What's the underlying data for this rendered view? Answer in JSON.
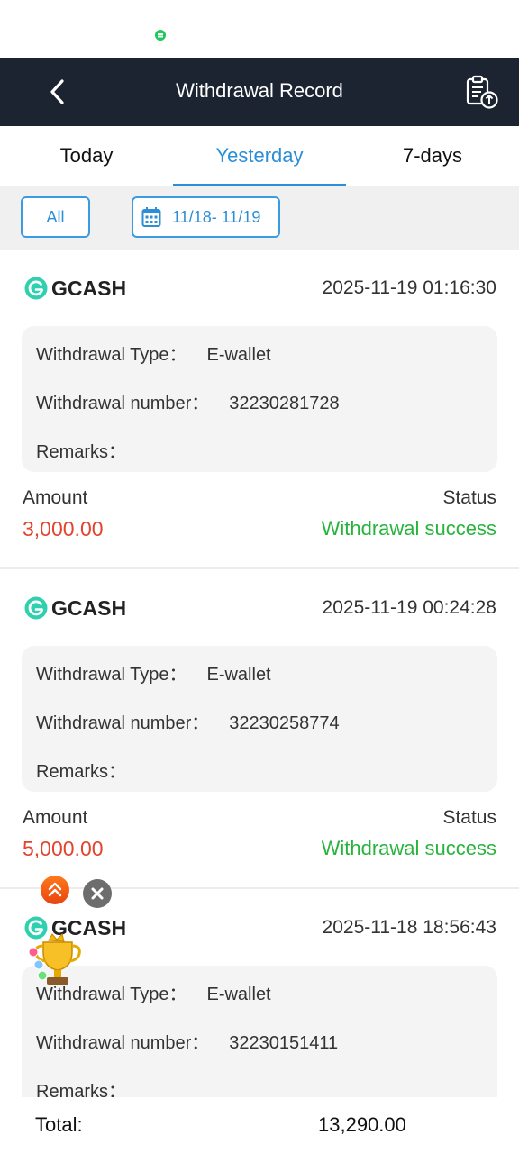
{
  "header": {
    "title": "Withdrawal Record",
    "back_icon": "chevron-left-icon",
    "export_icon": "clipboard-upload-icon"
  },
  "tabs": [
    {
      "label": "Today",
      "active": false
    },
    {
      "label": "Yesterday",
      "active": true
    },
    {
      "label": "7-days",
      "active": false
    }
  ],
  "filter": {
    "all_label": "All",
    "date_range": "11/18- 11/19",
    "date_icon": "calendar-icon"
  },
  "labels": {
    "withdrawal_type": "Withdrawal Type：",
    "withdrawal_number": "Withdrawal number：",
    "remarks": "Remarks：",
    "amount": "Amount",
    "status": "Status"
  },
  "records": [
    {
      "brand": "GCASH",
      "time": "2025-11-19 01:16:30",
      "type": "E-wallet",
      "number": "32230281728",
      "remarks": "",
      "amount": "3,000.00",
      "status": "Withdrawal success"
    },
    {
      "brand": "GCASH",
      "time": "2025-11-19 00:24:28",
      "type": "E-wallet",
      "number": "32230258774",
      "remarks": "",
      "amount": "5,000.00",
      "status": "Withdrawal success"
    },
    {
      "brand": "GCASH",
      "time": "2025-11-18 18:56:43",
      "type": "E-wallet",
      "number": "32230151411",
      "remarks": "",
      "amount": "",
      "status": ""
    }
  ],
  "total": {
    "label": "Total:",
    "value": "13,290.00"
  },
  "colors": {
    "header_bg": "#1c2431",
    "accent": "#2c8fd6",
    "amount": "#e2442f",
    "success": "#27b43c",
    "gcash": "#2fd0b0"
  }
}
